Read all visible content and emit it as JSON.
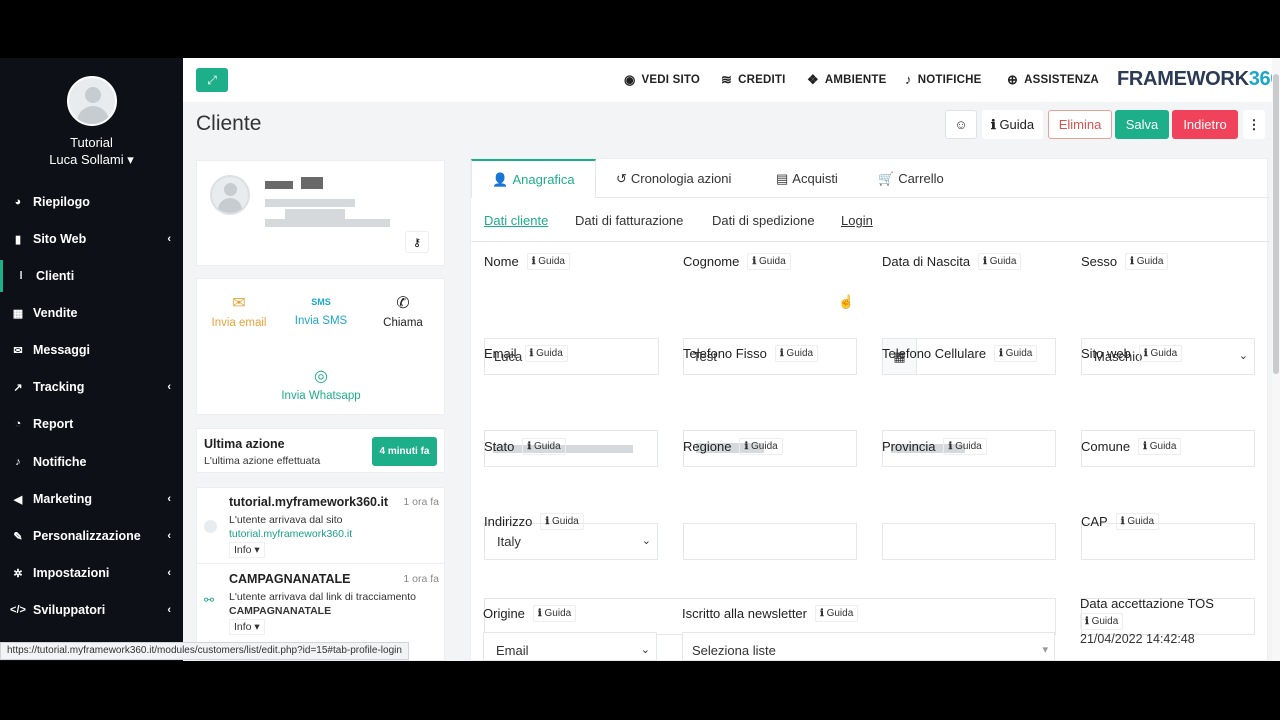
{
  "sidebar": {
    "user_line1": "Tutorial",
    "user_line2": "Luca Sollami ▾",
    "items": [
      {
        "label": "Riepilogo",
        "icon": "dashboard-icon"
      },
      {
        "label": "Sito Web",
        "icon": "file-icon"
      },
      {
        "label": "Clienti",
        "icon": "user-icon"
      },
      {
        "label": "Vendite",
        "icon": "table-icon"
      },
      {
        "label": "Messaggi",
        "icon": "envelope-icon"
      },
      {
        "label": "Tracking",
        "icon": "chart-icon"
      },
      {
        "label": "Report",
        "icon": "pie-icon"
      },
      {
        "label": "Notifiche",
        "icon": "bell-icon"
      },
      {
        "label": "Marketing",
        "icon": "megaphone-icon"
      },
      {
        "label": "Personalizzazione",
        "icon": "brush-icon"
      },
      {
        "label": "Impostazioni",
        "icon": "gear-icon"
      },
      {
        "label": "Sviluppatori",
        "icon": "code-icon"
      }
    ]
  },
  "status_url": "https://tutorial.myframework360.it/modules/customers/list/edit.php?id=15#tab-profile-login",
  "topbar": {
    "links": [
      "VEDI SITO",
      "CREDITI",
      "AMBIENTE",
      "NOTIFICHE",
      "ASSISTENZA"
    ],
    "brand_text": "FRAMEWORK",
    "brand_num": "360"
  },
  "header": {
    "title": "Cliente",
    "guida": "Guida",
    "elimina": "Elimina",
    "salva": "Salva",
    "indietro": "Indietro"
  },
  "actions": {
    "email": "Invia email",
    "sms": "Invia SMS",
    "chiama": "Chiama",
    "whatsapp": "Invia Whatsapp",
    "sms_icon_text": "SMS"
  },
  "ultima": {
    "title": "Ultima azione",
    "sub": "L'ultima azione effettuata",
    "badge": "4 minuti fa"
  },
  "timeline": [
    {
      "title": "tutorial.myframework360.it",
      "time": "1 ora fa",
      "line1": "L'utente arrivava dal sito",
      "link": "tutorial.myframework360.it",
      "info": "Info ▾"
    },
    {
      "title": "CAMPAGNANATALE",
      "time": "1 ora fa",
      "line1": "L'utente arrivava dal link di tracciamento",
      "line2": "CAMPAGNANATALE",
      "info": "Info ▾"
    }
  ],
  "tabs": [
    "Anagrafica",
    "Cronologia azioni",
    "Acquisti",
    "Carrello"
  ],
  "subtabs": [
    "Dati cliente",
    "Dati di fatturazione",
    "Dati di spedizione",
    "Login"
  ],
  "guida_label": "Guida",
  "fields": {
    "nome": {
      "label": "Nome",
      "value": "Luca"
    },
    "cognome": {
      "label": "Cognome",
      "value": "Test"
    },
    "nascita": {
      "label": "Data di Nascita",
      "value": ""
    },
    "sesso": {
      "label": "Sesso",
      "value": "Maschio"
    },
    "email": {
      "label": "Email"
    },
    "tel_fisso": {
      "label": "Telefono Fisso"
    },
    "tel_cell": {
      "label": "Telefono Cellulare"
    },
    "sito": {
      "label": "Sito web",
      "value": ""
    },
    "stato": {
      "label": "Stato",
      "value": "Italy"
    },
    "regione": {
      "label": "Regione",
      "value": ""
    },
    "provincia": {
      "label": "Provincia",
      "value": ""
    },
    "comune": {
      "label": "Comune",
      "value": ""
    },
    "indirizzo": {
      "label": "Indirizzo",
      "value": ""
    },
    "cap": {
      "label": "CAP",
      "value": ""
    },
    "origine": {
      "label": "Origine",
      "value": "Email"
    },
    "newsletter": {
      "label": "Iscritto alla newsletter",
      "value": "Seleziona liste"
    },
    "tos": {
      "label": "Data accettazione TOS",
      "value": "21/04/2022 14:42:48"
    }
  },
  "colors": {
    "accent": "#1dae8a",
    "danger": "#f0425b",
    "sidebar": "#0d1117"
  }
}
